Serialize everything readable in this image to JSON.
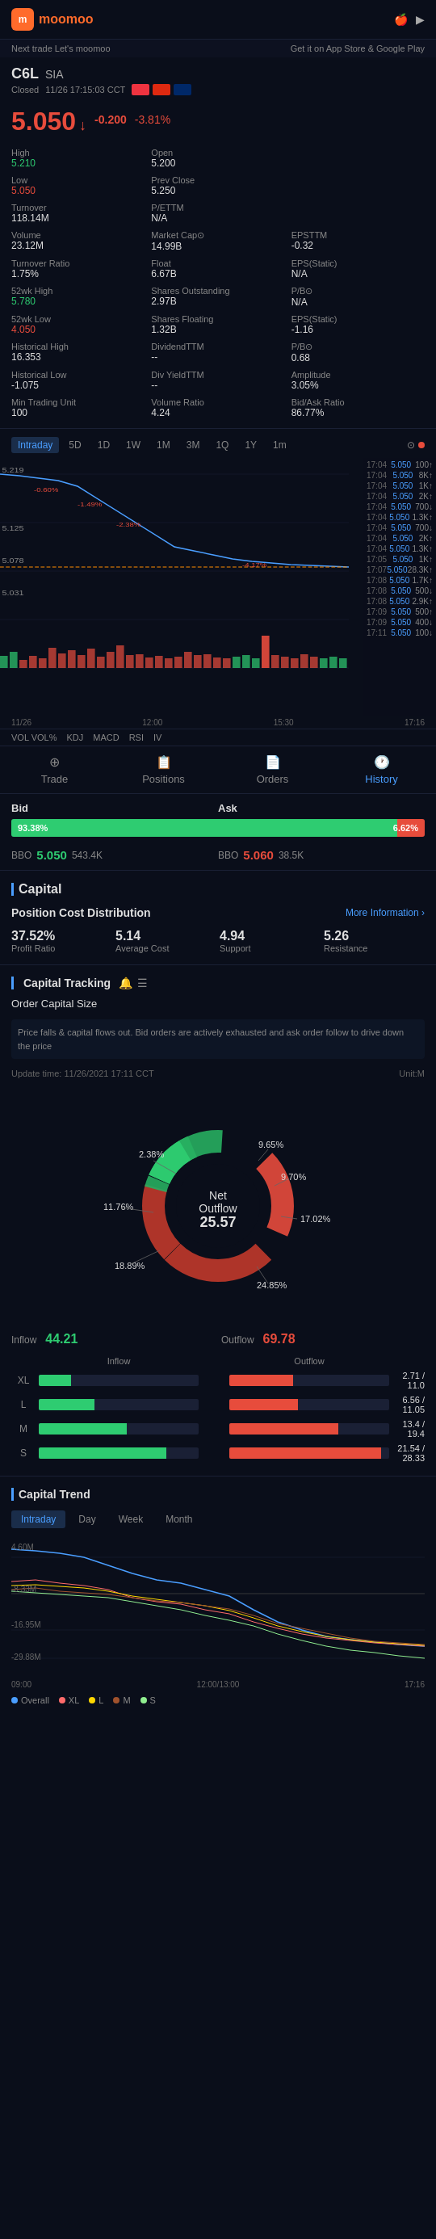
{
  "header": {
    "logo_text": "moomoo",
    "sub_left": "Next trade Let's moomoo",
    "sub_right": "Get it on App Store & Google Play",
    "apple_icon": "🍎",
    "android_icon": "▶"
  },
  "stock": {
    "code": "C6L",
    "exchange": "SIA",
    "status": "Closed",
    "time": "11/26 17:15:03 CCT",
    "price": "5.050",
    "change_abs": "-0.200",
    "change_pct": "-3.81%",
    "arrow": "↓"
  },
  "stats": {
    "high": {
      "label": "High",
      "value": "5.210"
    },
    "open": {
      "label": "Open",
      "value": "5.200"
    },
    "low": {
      "label": "Low",
      "value": "5.050"
    },
    "prev_close": {
      "label": "Prev Close",
      "value": "5.250"
    },
    "turnover": {
      "label": "Turnover",
      "value": "118.14M"
    },
    "pe_ttm": {
      "label": "P/ETTM",
      "value": "N/A"
    },
    "volume": {
      "label": "Volume",
      "value": "23.12M"
    },
    "market_cap": {
      "label": "Market Cap⊙",
      "value": "14.99B"
    },
    "eps_ttm": {
      "label": "EPSTTM",
      "value": "-0.32"
    },
    "turnover_ratio": {
      "label": "Turnover Ratio",
      "value": "1.75%"
    },
    "float": {
      "label": "Float",
      "value": "6.67B"
    },
    "eps_static": {
      "label": "EPS(Static)",
      "value": "N/A"
    },
    "wk52_high": {
      "label": "52wk High",
      "value": "5.780"
    },
    "shares_outstanding": {
      "label": "Shares Outstanding",
      "value": "2.97B"
    },
    "pb": {
      "label": "P/B⊙",
      "value": "N/A"
    },
    "wk52_low": {
      "label": "52wk Low",
      "value": "4.050"
    },
    "shares_floating": {
      "label": "Shares Floating",
      "value": "1.32B"
    },
    "eps_static2": {
      "label": "EPS(Static)",
      "value": "-1.16"
    },
    "hist_high": {
      "label": "Historical High",
      "value": "16.353"
    },
    "dividend": {
      "label": "DividendTTM",
      "value": "--"
    },
    "pb2": {
      "label": "P/B⊙",
      "value": "0.68"
    },
    "hist_low": {
      "label": "Historical Low",
      "value": "-1.075"
    },
    "div_yield": {
      "label": "Div YieldTTM",
      "value": "--"
    },
    "amplitude": {
      "label": "Amplitude",
      "value": "3.05%"
    },
    "min_unit": {
      "label": "Min Trading Unit",
      "value": "100"
    },
    "vol_ratio": {
      "label": "Volume Ratio",
      "value": "4.24"
    },
    "bid_ask_ratio": {
      "label": "Bid/Ask Ratio",
      "value": "86.77%"
    }
  },
  "chart_tabs": [
    "Intraday",
    "5D",
    "1D",
    "1W",
    "1M",
    "3M",
    "1Q",
    "1Y",
    "1m"
  ],
  "order_book": [
    {
      "time": "17:04",
      "price": "5.050",
      "vol": "100↑"
    },
    {
      "time": "17:04",
      "price": "5.050",
      "vol": "8K↑"
    },
    {
      "time": "17:04",
      "price": "5.050",
      "vol": "1K↑"
    },
    {
      "time": "17:04",
      "price": "5.050",
      "vol": "2K↑"
    },
    {
      "time": "17:04",
      "price": "5.050",
      "vol": "700↓"
    },
    {
      "time": "17:04",
      "price": "5.050",
      "vol": "1.3K↑"
    },
    {
      "time": "17:04",
      "price": "5.050",
      "vol": "700↓"
    },
    {
      "time": "17:04",
      "price": "5.050",
      "vol": "2K↑"
    },
    {
      "time": "17:04",
      "price": "5.050",
      "vol": "1.3K↑"
    },
    {
      "time": "17:05",
      "price": "5.050",
      "vol": "1K↑"
    },
    {
      "time": "17:07",
      "price": "5.050",
      "vol": "28.3K↑"
    },
    {
      "time": "17:08",
      "price": "5.050",
      "vol": "1.7K↑"
    },
    {
      "time": "17:08",
      "price": "5.050",
      "vol": "500↓"
    },
    {
      "time": "17:08",
      "price": "5.050",
      "vol": "2.9K↑"
    },
    {
      "time": "17:09",
      "price": "5.050",
      "vol": "500↑"
    },
    {
      "time": "17:09",
      "price": "5.050",
      "vol": "400↓"
    },
    {
      "time": "17:11",
      "price": "5.050",
      "vol": "100↓"
    }
  ],
  "chart_y_labels": [
    {
      "value": "5.219",
      "top_pct": 2
    },
    {
      "value": "5.125",
      "top_pct": 28
    },
    {
      "value": "5.078",
      "top_pct": 41
    },
    {
      "value": "5.031",
      "top_pct": 54
    }
  ],
  "chart_time_labels": [
    "11/26",
    "12:00",
    "15:30",
    "17:16"
  ],
  "vol_labels": [
    "VOL VOL%"
  ],
  "chart_bottom_labels": [
    "VOL VOL%",
    "KDJ",
    "MACD",
    "RSI",
    "IV"
  ],
  "nav": {
    "items": [
      {
        "id": "trade",
        "label": "Trade",
        "icon": "⊕"
      },
      {
        "id": "positions",
        "label": "Positions",
        "icon": "📋"
      },
      {
        "id": "orders",
        "label": "Orders",
        "icon": "📄"
      },
      {
        "id": "history",
        "label": "History",
        "icon": "🕐",
        "active": true
      }
    ]
  },
  "bid_ask": {
    "bid_label": "Bid",
    "ask_label": "Ask",
    "bid_pct": "93.38%",
    "ask_pct": "6.62%",
    "bbo_bid_label": "BBO",
    "bbo_bid_price": "5.050",
    "bbo_bid_vol": "543.4K",
    "bbo_ask_label": "BBO",
    "bbo_ask_price": "5.060",
    "bbo_ask_vol": "38.5K"
  },
  "capital": {
    "title": "Capital",
    "pos_cost_title": "Position Cost Distribution",
    "pos_cost_more": "More Information ›",
    "pos_stats": [
      {
        "value": "37.52%",
        "label": "Profit Ratio"
      },
      {
        "value": "5.14",
        "label": "Average Cost"
      },
      {
        "value": "4.94",
        "label": "Support"
      },
      {
        "value": "5.26",
        "label": "Resistance"
      }
    ],
    "tracking_title": "Capital Tracking",
    "order_cap_title": "Order Capital Size",
    "description": "Price falls & capital flows out. Bid orders are actively exhausted and ask order follow to drive down the price",
    "update_label": "Update time:",
    "update_time": "11/26/2021 17:11 CCT",
    "unit_label": "Unit:M",
    "donut": {
      "center_label": "Net\nOutflow",
      "center_value": "25.57",
      "segments": [
        {
          "label": "2.38%",
          "color": "#2ecc71",
          "position": "top-left"
        },
        {
          "label": "11.76%",
          "color": "#2ecc71",
          "position": "left"
        },
        {
          "label": "18.89%",
          "color": "#e74c3c",
          "position": "bottom-left"
        },
        {
          "label": "24.85%",
          "color": "#e74c3c",
          "position": "bottom-right"
        },
        {
          "label": "17.02%",
          "color": "#e74c3c",
          "position": "right"
        },
        {
          "label": "9.70%",
          "color": "#2ecc71",
          "position": "top-right-low"
        },
        {
          "label": "9.65%",
          "color": "#2ecc71",
          "position": "top-right"
        }
      ]
    },
    "inflow_label": "Inflow",
    "inflow_value": "44.21",
    "outflow_label": "Outflow",
    "outflow_value": "69.78",
    "flow_bars": [
      {
        "category": "XL",
        "inflow": 2.71,
        "outflow": 11.0,
        "inflow_str": "2.71",
        "outflow_str": "11.0"
      },
      {
        "category": "L",
        "inflow": 6.56,
        "outflow": 11.05,
        "inflow_str": "6.56",
        "outflow_str": "11.05"
      },
      {
        "category": "M",
        "inflow": 13.4,
        "outflow": 19.4,
        "inflow_str": "13.4",
        "outflow_str": "19.4"
      },
      {
        "category": "S",
        "inflow": 21.54,
        "outflow": 28.33,
        "inflow_str": "21.54",
        "outflow_str": "28.33"
      }
    ]
  },
  "trend": {
    "title": "Capital Trend",
    "tabs": [
      "Intraday",
      "Day",
      "Week",
      "Month"
    ],
    "active_tab": "Intraday",
    "y_labels": [
      "4.60M",
      "8.33M",
      "-16.95M",
      "-29.88M"
    ],
    "x_labels": [
      "09:00",
      "12:00/13:00",
      "17:16"
    ],
    "legend": [
      {
        "label": "Overall",
        "color": "#4a9eff"
      },
      {
        "label": "XL",
        "color": "#ff6b6b"
      },
      {
        "label": "L",
        "color": "#ffd700"
      },
      {
        "label": "M",
        "color": "#a0522d"
      },
      {
        "label": "S",
        "color": "#90ee90"
      }
    ]
  }
}
